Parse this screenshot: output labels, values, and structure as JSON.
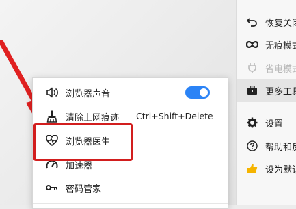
{
  "main_menu": {
    "items": [
      {
        "label": "恢复关闭",
        "icon": "undo-icon",
        "state": "normal"
      },
      {
        "label": "无痕模式",
        "icon": "incognito-icon",
        "state": "normal"
      },
      {
        "label": "省电模式",
        "icon": "plug-icon",
        "state": "disabled"
      },
      {
        "label": "更多工具",
        "icon": "toolbox-icon",
        "state": "active"
      },
      {
        "label": "设置",
        "icon": "gear-icon",
        "state": "normal"
      },
      {
        "label": "帮助和反馈",
        "icon": "help-icon",
        "state": "normal"
      },
      {
        "label": "设为默认",
        "icon": "thumbs-up-icon",
        "state": "normal"
      }
    ]
  },
  "submenu": {
    "items": [
      {
        "label": "浏览器声音",
        "icon": "speaker-icon",
        "toggle": true
      },
      {
        "label": "清除上网痕迹",
        "icon": "broom-icon",
        "shortcut": "Ctrl+Shift+Delete"
      },
      {
        "label": "浏览器医生",
        "icon": "heart-monitor-icon"
      },
      {
        "label": "加速器",
        "icon": "speedometer-icon"
      },
      {
        "label": "密码管家",
        "icon": "key-icon"
      }
    ]
  },
  "colors": {
    "toggle_on": "#2b83f6",
    "highlight": "#d21e1e",
    "arrow": "#e02020"
  }
}
